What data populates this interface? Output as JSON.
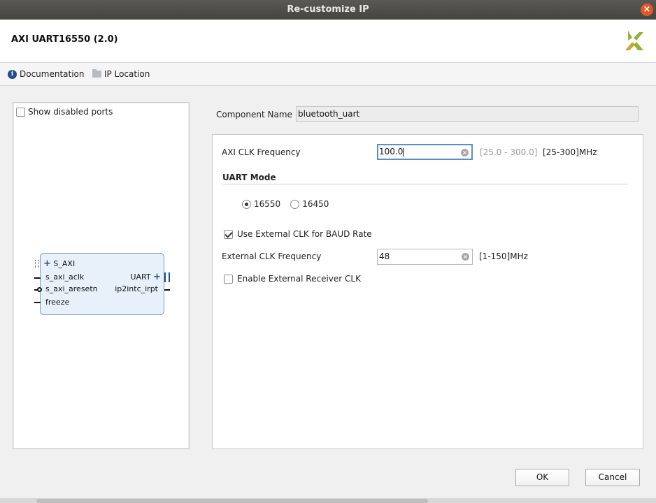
{
  "window": {
    "title": "Re-customize IP",
    "close_glyph": "×"
  },
  "header": {
    "ip_title": "AXI UART16550 (2.0)"
  },
  "toolbar": {
    "documentation": "Documentation",
    "ip_location": "IP Location"
  },
  "left": {
    "show_disabled_ports": "Show disabled ports",
    "block": {
      "left_ports": [
        "S_AXI",
        "s_axi_aclk",
        "s_axi_aresetn",
        "freeze"
      ],
      "right_ports": [
        "UART",
        "ip2intc_irpt"
      ]
    }
  },
  "component": {
    "label": "Component Name",
    "value": "bluetooth_uart"
  },
  "config": {
    "axi_clk": {
      "label": "AXI CLK Frequency",
      "value": "100.0",
      "range": "[25.0 - 300.0]",
      "unit": "[25-300]MHz"
    },
    "uart_mode": {
      "section": "UART Mode",
      "option1": "16550",
      "option2": "16450",
      "selected": "16550"
    },
    "use_ext_clk": {
      "label": "Use External CLK for BAUD Rate",
      "checked": true
    },
    "ext_clk": {
      "label": "External CLK Frequency",
      "value": "48",
      "unit": "[1-150]MHz"
    },
    "ext_rx_clk": {
      "label": "Enable External Receiver CLK",
      "checked": false
    }
  },
  "buttons": {
    "ok": "OK",
    "cancel": "Cancel"
  },
  "icons": {
    "documentation": "info-icon",
    "ip_location": "folder-icon",
    "clear": "clear-icon"
  },
  "colors": {
    "titlebar": "#4f4e49",
    "close": "#e2582b",
    "focus": "#5b8dc9",
    "block_fill": "#e8f1fa"
  }
}
